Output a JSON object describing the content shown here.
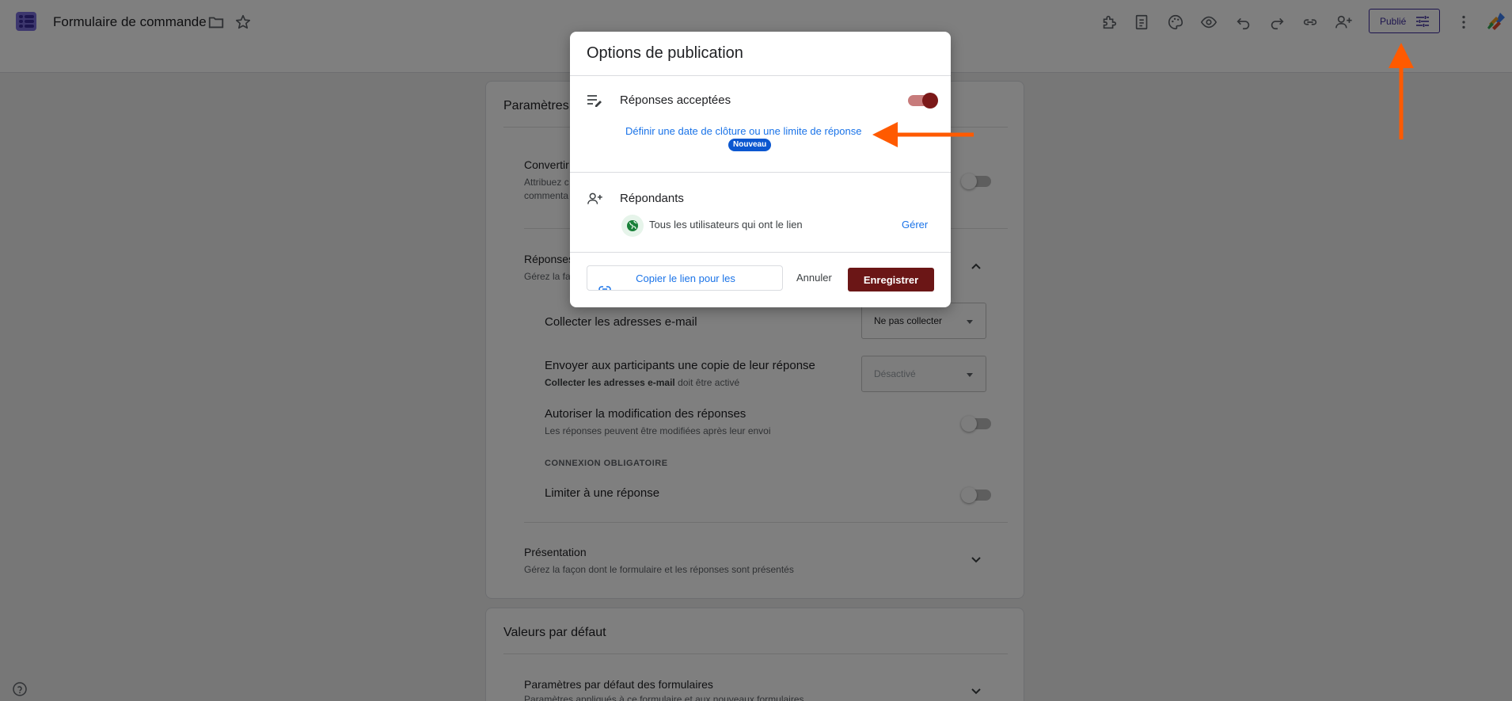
{
  "header": {
    "title": "Formulaire de commande",
    "publish_label": "Publié"
  },
  "settings_card": {
    "title": "Paramètres",
    "convert": {
      "label": "Convertir",
      "desc_line1": "Attribuez c",
      "desc_line2": "commenta"
    },
    "responses": {
      "label": "Réponses",
      "desc": "Gérez la fa"
    },
    "collect_email": {
      "label": "Collecter les adresses e-mail",
      "select_value": "Ne pas collecter"
    },
    "send_copy": {
      "label": "Envoyer aux participants une copie de leur réponse",
      "note_bold": "Collecter les adresses e-mail",
      "note_rest": " doit être activé",
      "select_value": "Désactivé"
    },
    "allow_edit": {
      "label": "Autoriser la modification des réponses",
      "desc": "Les réponses peuvent être modifiées après leur envoi"
    },
    "login_required_caption": "CONNEXION OBLIGATOIRE",
    "limit_one": {
      "label": "Limiter à une réponse"
    },
    "presentation": {
      "label": "Présentation",
      "desc": "Gérez la façon dont le formulaire et les réponses sont présentés"
    }
  },
  "defaults_card": {
    "title": "Valeurs par défaut",
    "form_defaults": {
      "label": "Paramètres par défaut des formulaires",
      "desc": "Paramètres appliqués à ce formulaire et aux nouveaux formulaires"
    }
  },
  "modal": {
    "title": "Options de publication",
    "accepting": {
      "label": "Réponses acceptées",
      "on": true
    },
    "limit_link": "Définir une date de clôture ou une limite de réponse",
    "new_badge": "Nouveau",
    "respondents": {
      "label": "Répondants",
      "access_text": "Tous les utilisateurs qui ont le lien",
      "manage_label": "Gérer"
    },
    "copy_link_label": "Copier le lien pour les",
    "cancel_label": "Annuler",
    "save_label": "Enregistrer"
  },
  "colors": {
    "accent": "#3c2a9c",
    "save": "#6b1616",
    "link": "#1a73e8",
    "annotation_arrow": "#ff5a00"
  },
  "icons": [
    "forms-logo-icon",
    "folder-icon",
    "star-icon",
    "addon-icon",
    "checklist-icon",
    "palette-icon",
    "preview-eye-icon",
    "undo-icon",
    "redo-icon",
    "link-icon",
    "add-person-icon",
    "tune-icon",
    "more-vert-icon",
    "account-logo-icon",
    "edit-list-icon",
    "add-person-icon",
    "globe-icon",
    "chevron-up-icon",
    "chevron-down-icon",
    "help-icon"
  ]
}
